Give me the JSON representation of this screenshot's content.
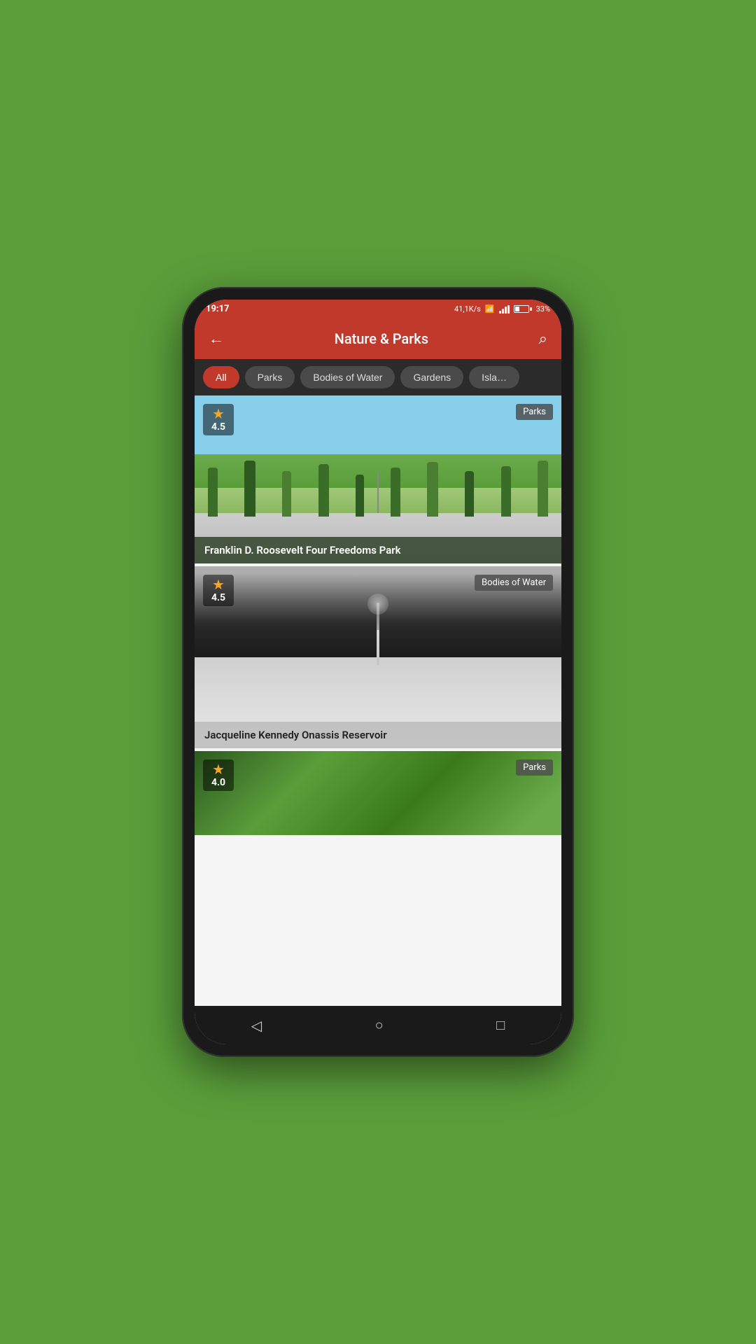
{
  "status_bar": {
    "time": "19:17",
    "speed": "41,1K/s",
    "battery_pct": "33%"
  },
  "app_bar": {
    "title": "Nature & Parks",
    "back_label": "←",
    "search_label": "🔍"
  },
  "filters": [
    {
      "id": "all",
      "label": "All",
      "active": true
    },
    {
      "id": "parks",
      "label": "Parks",
      "active": false
    },
    {
      "id": "bodies",
      "label": "Bodies of Water",
      "active": false
    },
    {
      "id": "gardens",
      "label": "Gardens",
      "active": false
    },
    {
      "id": "islands",
      "label": "Isla…",
      "active": false
    }
  ],
  "places": [
    {
      "id": 1,
      "title": "Franklin D. Roosevelt Four Freedoms Park",
      "rating": "4.5",
      "category": "Parks",
      "image_type": "park"
    },
    {
      "id": 2,
      "title": "Jacqueline Kennedy Onassis Reservoir",
      "rating": "4.5",
      "category": "Bodies of Water",
      "image_type": "reservoir"
    },
    {
      "id": 3,
      "title": "",
      "rating": "4.0",
      "category": "Parks",
      "image_type": "park3"
    }
  ],
  "nav": {
    "back": "◁",
    "home": "○",
    "recent": "□"
  },
  "colors": {
    "primary": "#c0392b",
    "chip_active": "#c0392b",
    "chip_inactive": "#4a4a4a",
    "star": "#f5a623"
  }
}
